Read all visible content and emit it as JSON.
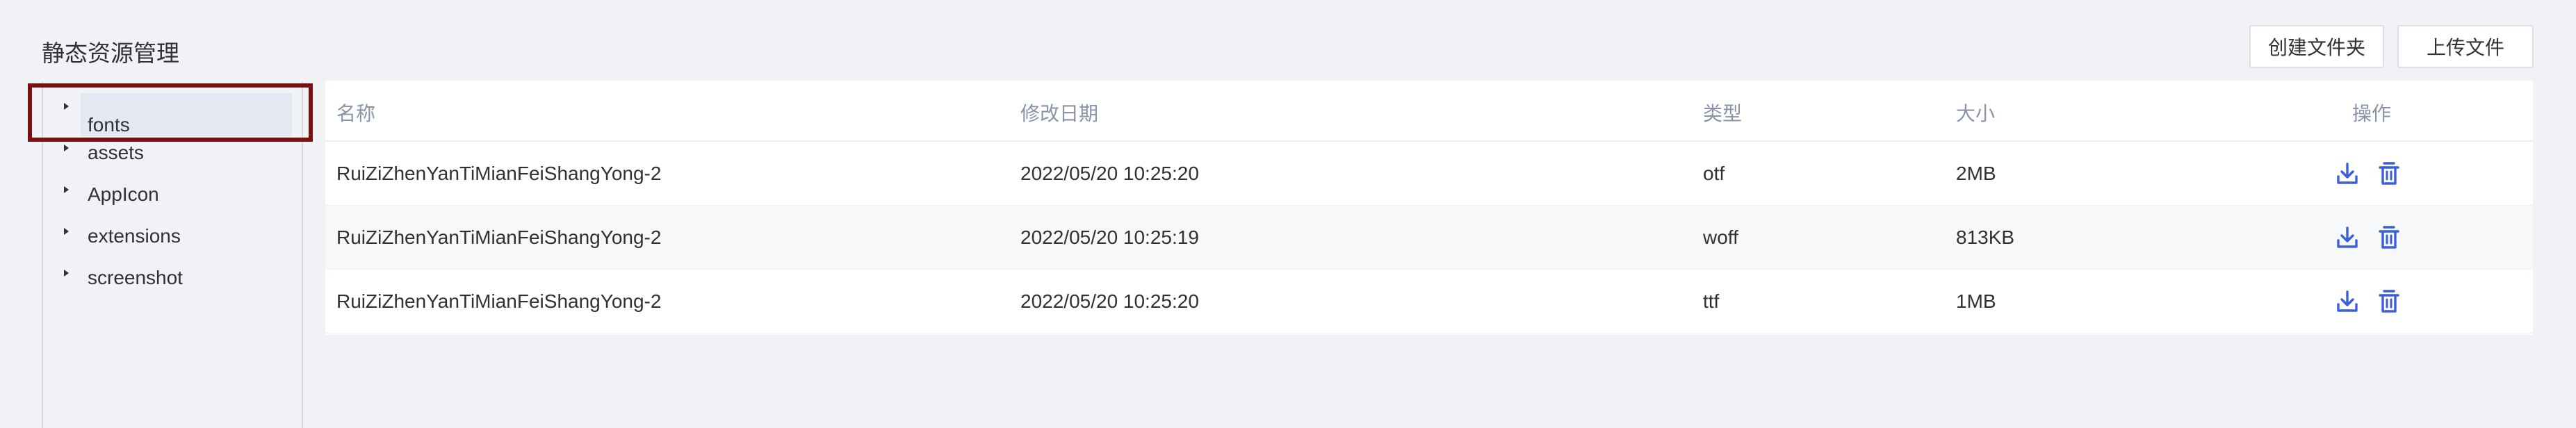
{
  "header": {
    "title": "静态资源管理",
    "create_folder_label": "创建文件夹",
    "upload_label": "上传文件"
  },
  "tree": {
    "items": [
      {
        "label": "fonts",
        "selected": true
      },
      {
        "label": "assets"
      },
      {
        "label": "AppIcon"
      },
      {
        "label": "extensions"
      },
      {
        "label": "screenshot"
      }
    ]
  },
  "table": {
    "columns": [
      "名称",
      "修改日期",
      "类型",
      "大小",
      "操作"
    ],
    "rows": [
      {
        "name": "RuiZiZhenYanTiMianFeiShangYong-2",
        "date": "2022/05/20 10:25:20",
        "type": "otf",
        "size": "2MB"
      },
      {
        "name": "RuiZiZhenYanTiMianFeiShangYong-2",
        "date": "2022/05/20 10:25:19",
        "type": "woff",
        "size": "813KB"
      },
      {
        "name": "RuiZiZhenYanTiMianFeiShangYong-2",
        "date": "2022/05/20 10:25:20",
        "type": "ttf",
        "size": "1MB"
      }
    ],
    "row_actions": [
      {
        "icon": "download-icon"
      },
      {
        "icon": "trash-icon"
      }
    ]
  },
  "colors": {
    "accent": "#3a5fd9",
    "highlight_border": "#7a1010",
    "selected_bg": "#e4e8f2"
  }
}
